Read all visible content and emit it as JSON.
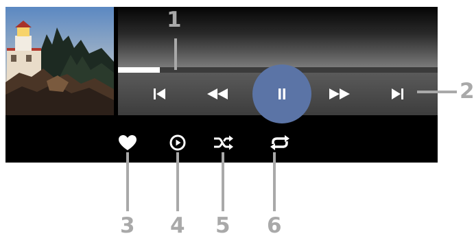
{
  "player": {
    "progress_percent": 13,
    "controls": [
      {
        "name": "previous-track-button",
        "icon": "skip-previous-icon"
      },
      {
        "name": "rewind-button",
        "icon": "rewind-icon"
      },
      {
        "name": "pause-button",
        "icon": "pause-icon"
      },
      {
        "name": "fast-forward-button",
        "icon": "fast-forward-icon"
      },
      {
        "name": "next-track-button",
        "icon": "skip-next-icon"
      }
    ],
    "actions": [
      {
        "name": "favorite-button",
        "icon": "heart-icon"
      },
      {
        "name": "play-all-button",
        "icon": "play-circle-icon"
      },
      {
        "name": "shuffle-button",
        "icon": "shuffle-icon"
      },
      {
        "name": "repeat-button",
        "icon": "repeat-icon"
      }
    ],
    "accent_color": "#5b74a6"
  },
  "callouts": [
    "1",
    "2",
    "3",
    "4",
    "5",
    "6"
  ]
}
